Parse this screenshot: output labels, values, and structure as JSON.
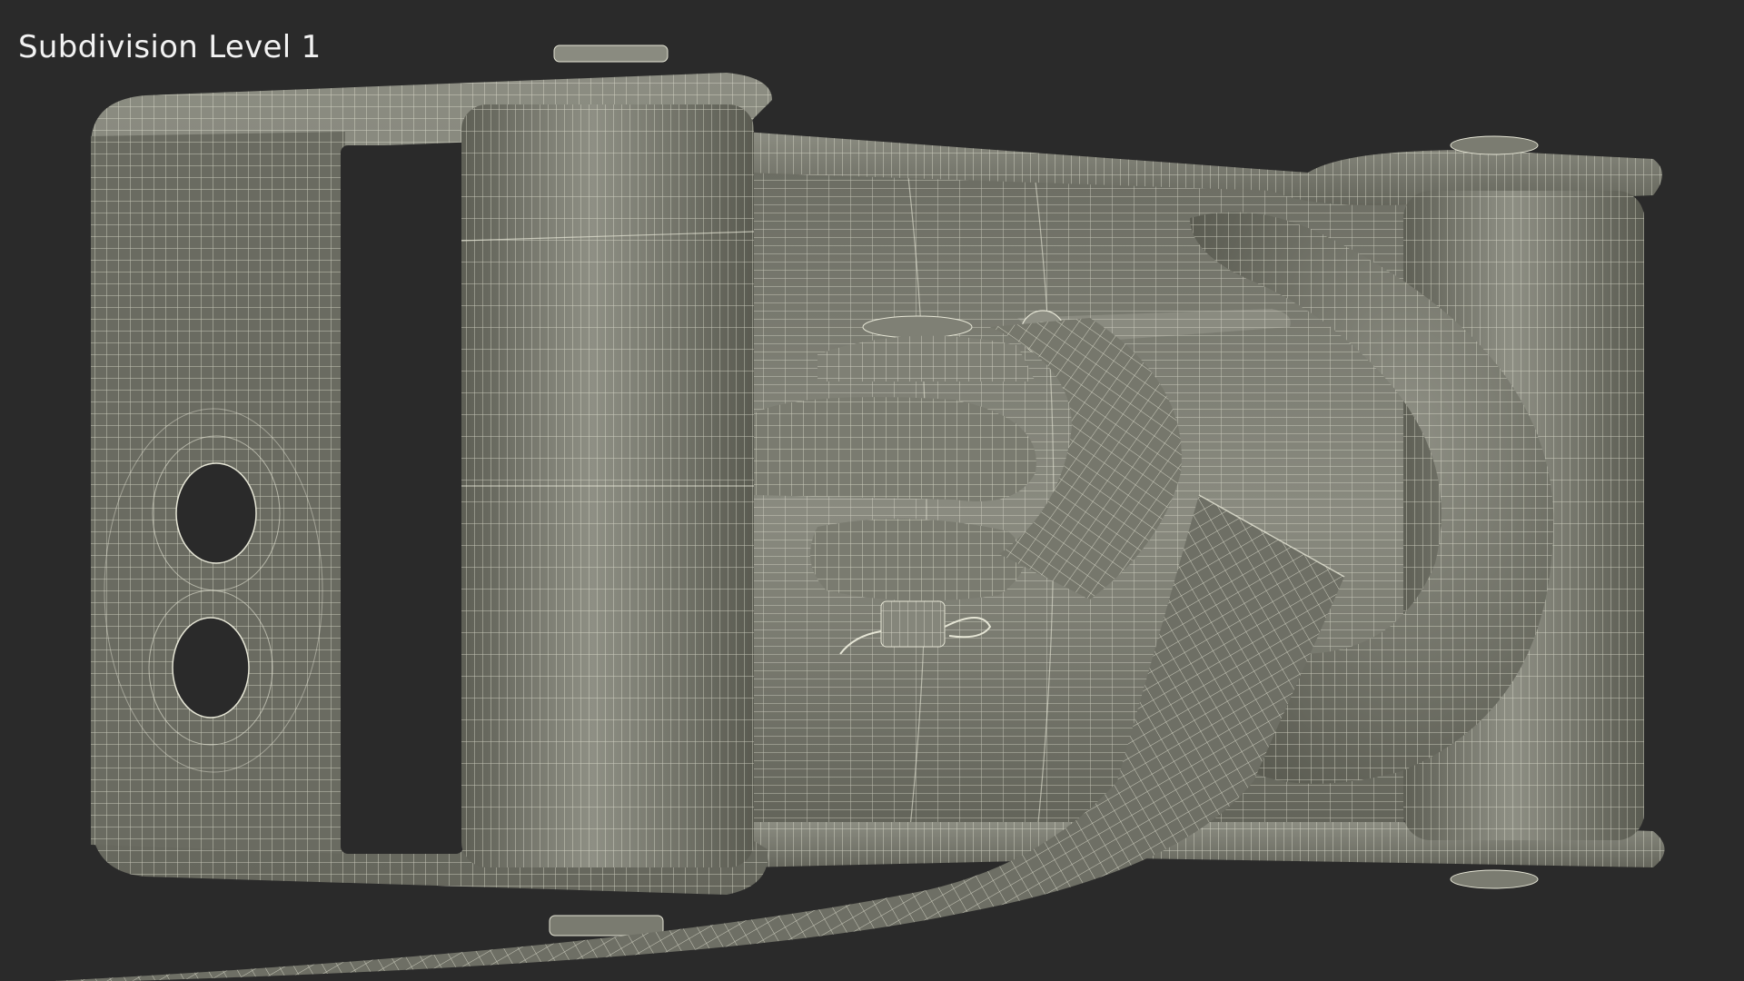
{
  "viewport": {
    "label": "Subdivision Level 1",
    "background": "#2a2a2a"
  },
  "render": {
    "subject": "ratchet-buckle-with-hook-and-strap",
    "display_mode": "wireframe-on-shaded",
    "colors": {
      "surface_dark": "#55564c",
      "surface_mid": "#7a7b70",
      "surface_light": "#9c9d92",
      "wire": "#e6e6d6",
      "hole": "#2a2a2a"
    }
  }
}
